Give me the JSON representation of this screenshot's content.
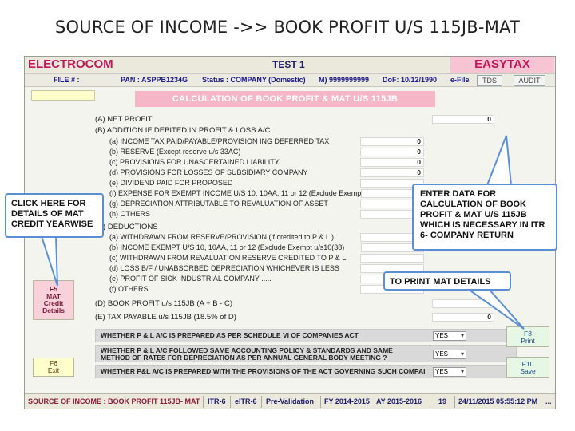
{
  "slide_title": "SOURCE OF INCOME ->> BOOK PROFIT U/S 115JB-MAT",
  "header": {
    "brand_left": "ELECTROCOM",
    "center_title": "TEST 1",
    "brand_right": "EASYTAX"
  },
  "info_bar": {
    "file": "FILE # :",
    "pan": "PAN : ASPPB1234G",
    "status": "Status : COMPANY (Domestic)",
    "mobile": "M) 9999999999",
    "dof": "DoF: 10/12/1990",
    "efile": "e-File",
    "tds_tab": "TDS",
    "audit_tab": "AUDIT"
  },
  "banner": "CALCULATION OF BOOK PROFIT & MAT U/S 115JB",
  "rows": [
    {
      "label": "(A)  NET PROFIT",
      "value": "0"
    },
    {
      "label": "(B)  ADDITION IF DEBITED IN PROFIT & LOSS A/C",
      "value": ""
    },
    {
      "label": "(a)  INCOME TAX PAID/PAYABLE/PROVISION ING DEFERRED TAX",
      "value": "0"
    },
    {
      "label": "(b)  RESERVE (Except reserve u/s 33AC)",
      "value": "0"
    },
    {
      "label": "(c)  PROVISIONS FOR UNASCERTAINED LIABILITY",
      "value": "0"
    },
    {
      "label": "(d)  PROVISIONS FOR LOSSES OF SUBSIDIARY COMPANY",
      "value": "0"
    },
    {
      "label": "(e)  DIVIDEND PAID FOR PROPOSED",
      "value": ""
    },
    {
      "label": "(f)  EXPENSE FOR EXEMPT INCOME U/S 10, 10AA, 11 or 12 (Exclude Exempt",
      "value": ""
    },
    {
      "label": "(g)  DEPRECIATION ATTRIBUTABLE TO REVALUATION OF ASSET",
      "value": ""
    },
    {
      "label": "(h)  OTHERS",
      "value": ""
    },
    {
      "label": "(C)  DEDUCTIONS",
      "value": ""
    },
    {
      "label": "(a)  WITHDRAWN FROM RESERVE/PROVISION (if credited to P & L )",
      "value": ""
    },
    {
      "label": "(b)  INCOME EXEMPT U/S 10, 10AA, 11 or 12 (Exclude Exempt u/s10(38)",
      "value": ""
    },
    {
      "label": "(c)  WITHDRAWN FROM REVALUATION RESERVE CREDITED TO P & L",
      "value": ""
    },
    {
      "label": "(d)  LOSS B/F / UNABSORBED DEPRECIATION WHICHEVER IS LESS",
      "value": ""
    },
    {
      "label": "(e)  PROFIT OF SICK INDUSTRIAL COMPANY .....",
      "value": ""
    },
    {
      "label": "(f)  OTHERS",
      "value": ""
    },
    {
      "label": "(D)  BOOK PROFIT u/s 115JB (A + B - C)",
      "value": ""
    },
    {
      "label": "(E)  TAX PAYABLE u/s 115JB (18.5% of D)",
      "value": "0"
    }
  ],
  "questions": [
    {
      "text": "WHETHER P & L A/C IS PREPARED AS PER SCHEDULE VI OF COMPANIES ACT",
      "answer": "YES"
    },
    {
      "text": "WHETHER P & L A/C FOLLOWED SAME ACCOUNTING POLICY & STANDARDS AND SAME",
      "text2": "METHOD OF RATES FOR DEPRECIATION AS PER ANNUAL GENERAL BODY MEETING ?",
      "answer": "YES"
    },
    {
      "text": "WHETHER P&L A/C IS PREPARED WITH THE PROVISIONS OF THE ACT GOVERNING SUCH COMPAI",
      "answer": "YES"
    }
  ],
  "buttons": {
    "f5_line1": "F5",
    "f5_line2": "MAT",
    "f5_line3": "Credit",
    "f5_line4": "Details",
    "f6_line1": "F6",
    "f6_line2": "Exit",
    "f8_line1": "F8",
    "f8_line2": "Print",
    "f10_line1": "F10",
    "f10_line2": "Save"
  },
  "status_bar": {
    "source": "SOURCE OF INCOME : BOOK PROFIT 115JB- MAT",
    "itr": "ITR-6",
    "eitr": "eITR-6",
    "prevalidation": "Pre-Validation",
    "fy": "FY 2014-2015",
    "ay": "AY 2015-2016",
    "count": "19",
    "datetime": "24/11/2015 05:55:12 PM",
    "dots": "..."
  },
  "callouts": {
    "left": "CLICK HERE FOR DETAILS OF MAT CREDIT YEARWISE",
    "right": "ENTER DATA FOR CALCULATION OF BOOK PROFIT & MAT U/S 115JB WHICH IS NECESSARY IN ITR 6- COMPANY RETURN",
    "print": "TO PRINT MAT DETAILS"
  },
  "colors": {
    "brand": "#c2185b",
    "banner": "#f5b6c8",
    "callout_border": "#5b8fd3"
  }
}
